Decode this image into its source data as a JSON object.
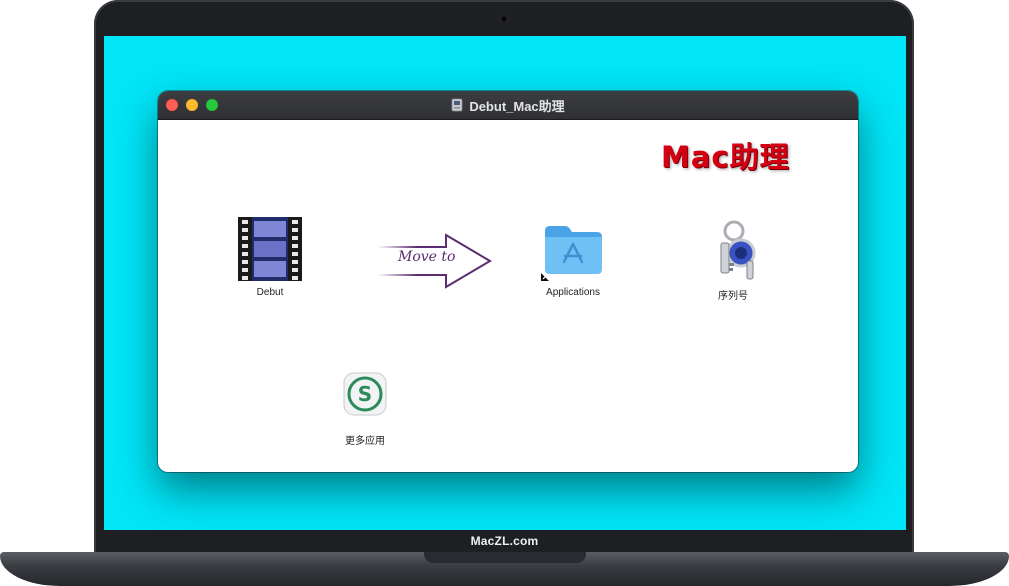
{
  "window": {
    "title": "Debut_Mac助理"
  },
  "watermark": "Mac助理",
  "arrow": {
    "text": "Move to"
  },
  "items": [
    {
      "label": "Debut",
      "icon": "film-reel-icon"
    },
    {
      "label": "Applications",
      "icon": "applications-folder-icon"
    },
    {
      "label": "序列号",
      "icon": "keychain-icon"
    },
    {
      "label": "更多应用",
      "icon": "more-apps-icon"
    }
  ],
  "device": {
    "label": "MacZL.com"
  },
  "colors": {
    "desktop": "#00e5f7",
    "close": "#ff5f57",
    "minimize": "#febc2e",
    "maximize": "#28c840",
    "watermark": "#d40012"
  }
}
